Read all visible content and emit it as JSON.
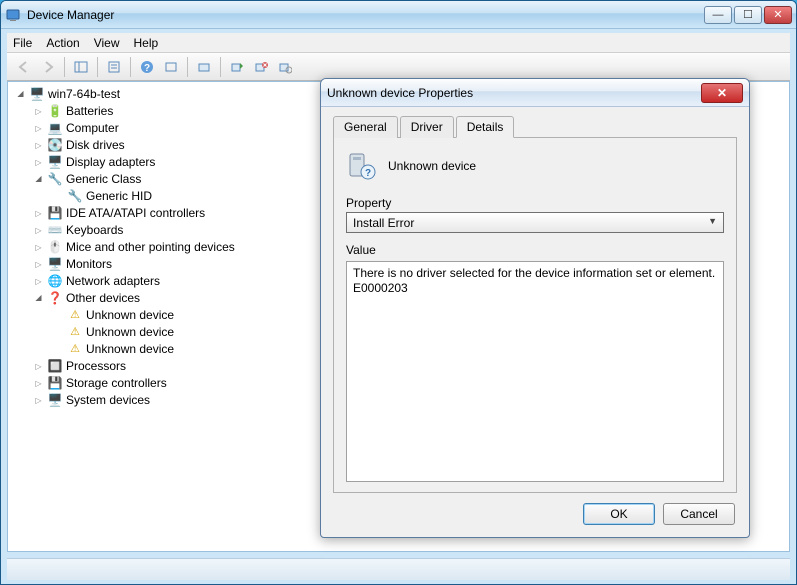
{
  "window": {
    "title": "Device Manager"
  },
  "menu": {
    "file": "File",
    "action": "Action",
    "view": "View",
    "help": "Help"
  },
  "tree": {
    "root": "win7-64b-test",
    "batteries": "Batteries",
    "computer": "Computer",
    "disk": "Disk drives",
    "display": "Display adapters",
    "generic_class": "Generic Class",
    "generic_hid": "Generic HID",
    "ide": "IDE ATA/ATAPI controllers",
    "keyboards": "Keyboards",
    "mice": "Mice and other pointing devices",
    "monitors": "Monitors",
    "network": "Network adapters",
    "other": "Other devices",
    "unknown1": "Unknown device",
    "unknown2": "Unknown device",
    "unknown3": "Unknown device",
    "processors": "Processors",
    "storage": "Storage controllers",
    "system": "System devices"
  },
  "dialog": {
    "title": "Unknown device Properties",
    "tabs": {
      "general": "General",
      "driver": "Driver",
      "details": "Details"
    },
    "device_name": "Unknown device",
    "property_label": "Property",
    "property_selected": "Install Error",
    "value_label": "Value",
    "value_line1": "There is no driver selected for the device information set or element.",
    "value_line2": "E0000203",
    "ok": "OK",
    "cancel": "Cancel"
  }
}
